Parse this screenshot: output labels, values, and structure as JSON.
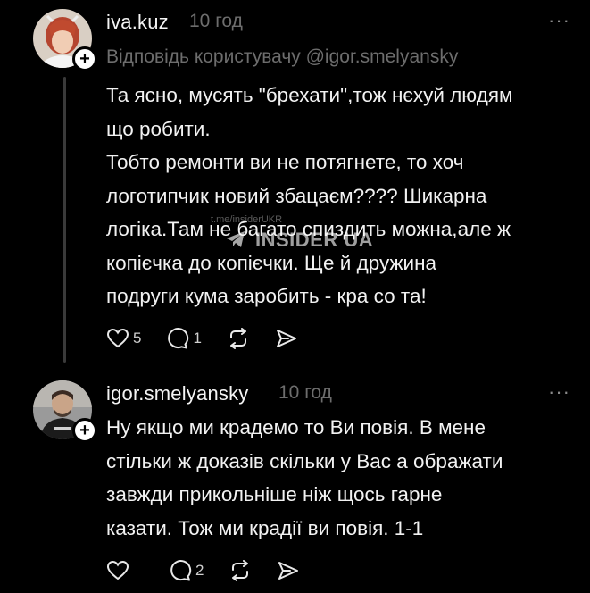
{
  "posts": [
    {
      "username": "iva.kuz",
      "time": "10 год",
      "more": "···",
      "reply_to": "Відповідь користувачу @igor.smelyansky",
      "lines": [
        "Та ясно, мусять \"брехати\",тож нєхуй людям",
        "що робити.",
        "Тобто ремонти ви не потягнете, то хоч",
        "логотипчик новий збацаєм???? Шикарна",
        "логіка.Там не багато спиздить можна,але ж",
        "копієчка до копієчки. Ще й дружина",
        "подруги кума заробить - кра со та!"
      ],
      "likes": "5",
      "replies": "1"
    },
    {
      "username": "igor.smelyansky",
      "time": "10 год",
      "more": "···",
      "lines": [
        "Ну якщо ми крадемо то Ви повія. В мене",
        "стільки ж доказів скільки у Вас а ображати",
        "завжди прикольніше ніж щось гарне",
        "казати. Тож ми крадії ви повія. 1-1"
      ],
      "likes": "",
      "replies": "2"
    }
  ],
  "watermark": {
    "channel": "t.me/insiderUKR",
    "name": "INSIDER UA"
  },
  "icons": {
    "like": "heart-icon",
    "reply": "comment-icon",
    "repost": "repost-icon",
    "share": "send-icon"
  }
}
